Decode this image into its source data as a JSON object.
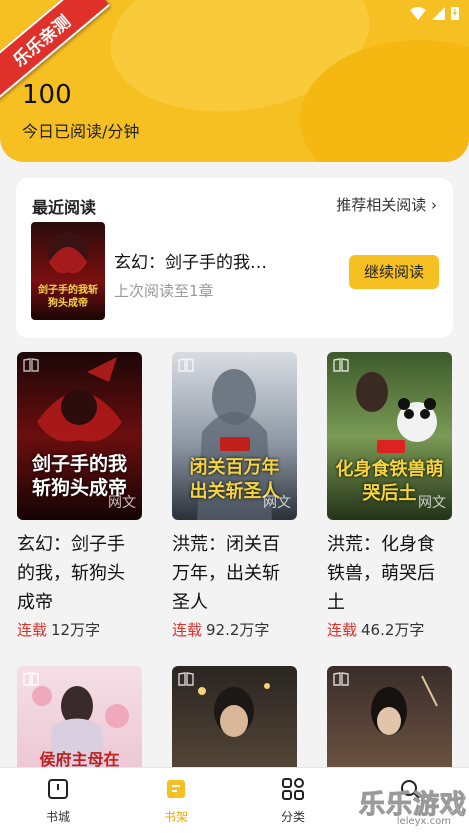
{
  "header": {
    "badge": "乐乐亲测",
    "read_minutes": "100",
    "read_label": "今日已阅读/分钟"
  },
  "recent": {
    "title": "最近阅读",
    "more_label": "推荐相关阅读 ›",
    "book_title": "玄幻：剑子手的我…",
    "progress": "上次阅读至1章",
    "continue_label": "继续阅读",
    "cover_text": "剑子手的我斩狗头成帝"
  },
  "books": [
    {
      "name": "玄幻：剑子手的我，斩狗头成帝",
      "status": "连载",
      "words": "12万字",
      "cover_text": "剑子手的我斩狗头成帝",
      "watermark": "网文"
    },
    {
      "name": "洪荒：闭关百万年，出关斩圣人",
      "status": "连载",
      "words": "92.2万字",
      "cover_text": "闭关百万年出关斩圣人",
      "watermark": "网文"
    },
    {
      "name": "洪荒：化身食铁兽，萌哭后土",
      "status": "连载",
      "words": "46.2万字",
      "cover_text": "化身食铁兽萌哭后土",
      "watermark": "网文"
    },
    {
      "name": "",
      "status": "",
      "words": "",
      "cover_text": "侯府主母在",
      "watermark": ""
    },
    {
      "name": "",
      "status": "",
      "words": "",
      "cover_text": "",
      "watermark": ""
    },
    {
      "name": "",
      "status": "",
      "words": "",
      "cover_text": "",
      "watermark": ""
    }
  ],
  "nav": [
    {
      "label": "书城",
      "icon": "book-city-icon"
    },
    {
      "label": "书架",
      "icon": "bookshelf-icon",
      "active": true
    },
    {
      "label": "分类",
      "icon": "category-icon"
    },
    {
      "label": "",
      "icon": "search-icon"
    }
  ],
  "site_watermark": {
    "big": "乐乐游戏",
    "small": "leleyx.com"
  },
  "colors": {
    "accent": "#f7c022",
    "status_red": "#e0302a"
  }
}
